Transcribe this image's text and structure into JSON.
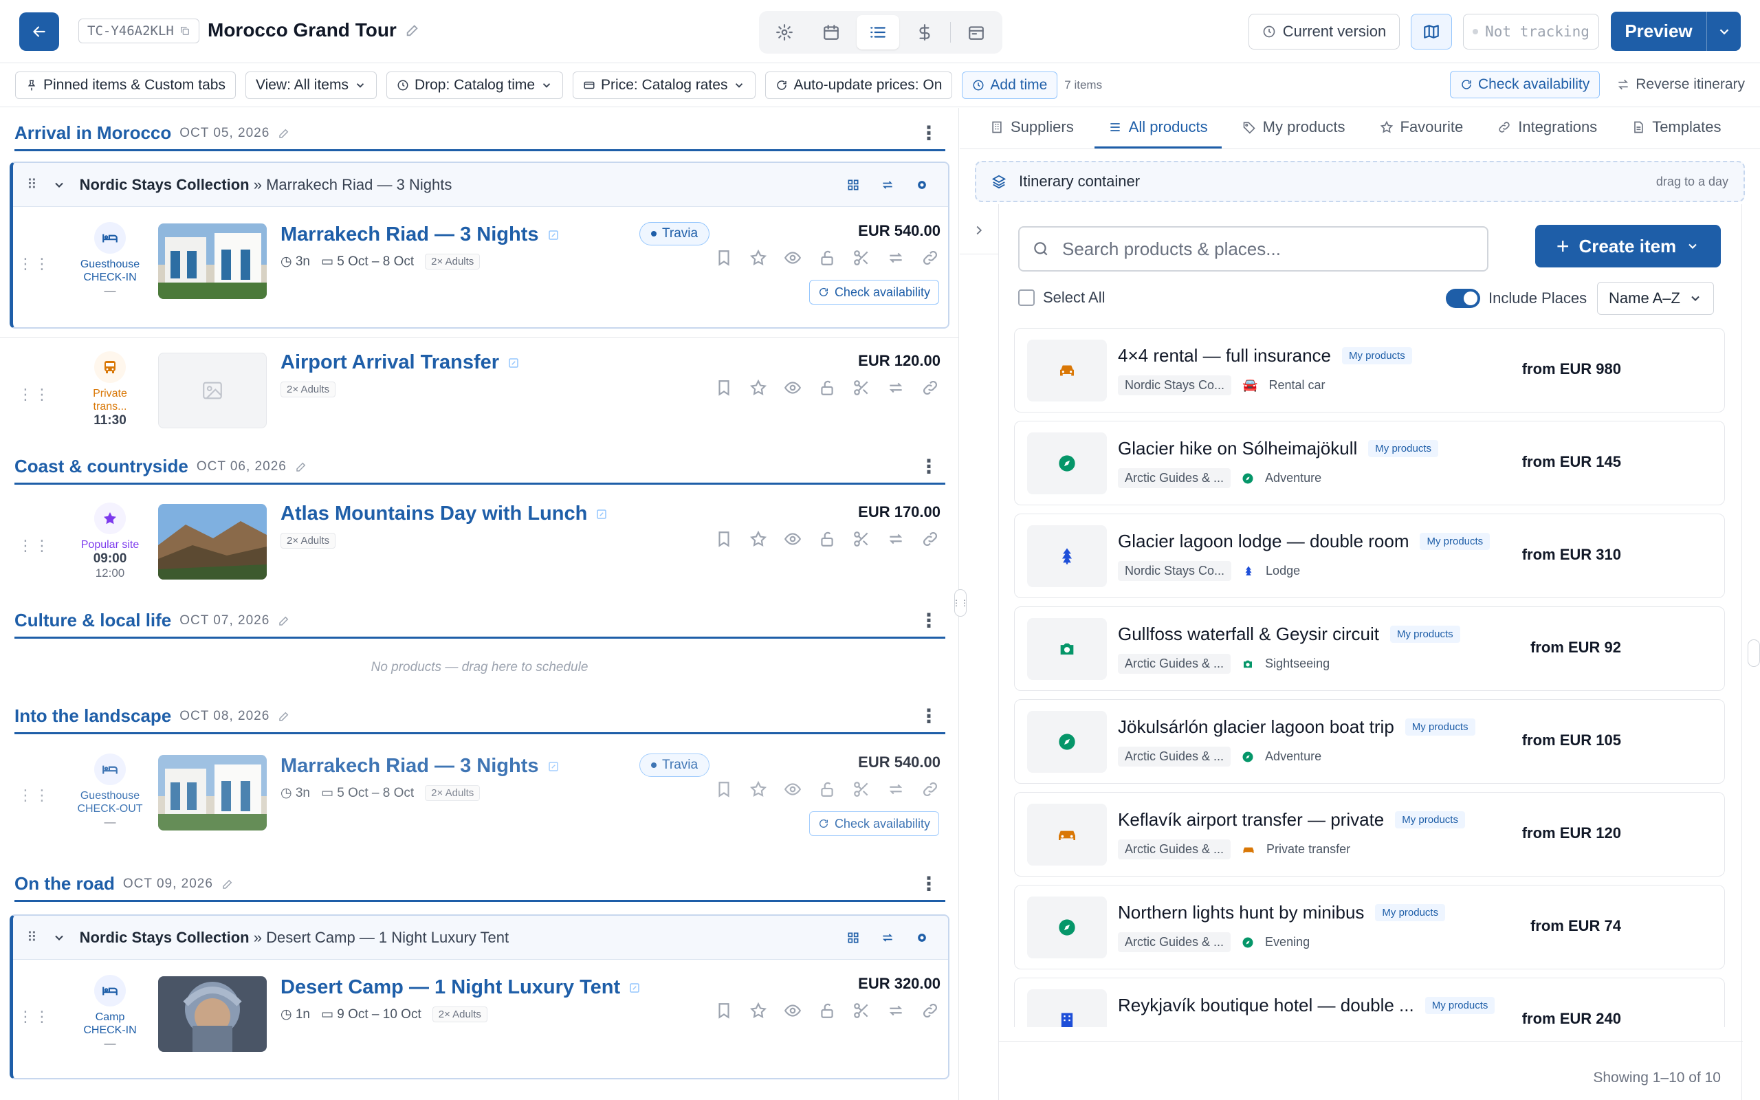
{
  "header": {
    "trip_code": "TC-Y46A2KLH",
    "title": "Morocco Grand Tour",
    "current_version": "Current version",
    "tracking": "Not tracking",
    "preview": "Preview"
  },
  "toolbar": {
    "pinned": "Pinned items & Custom tabs",
    "view": "View: All items",
    "drop": "Drop: Catalog time",
    "price": "Price: Catalog rates",
    "autoupdate": "Auto-update prices: On",
    "add_time": "Add time",
    "items_count": "7 items",
    "check_availability": "Check availability",
    "reverse": "Reverse itinerary"
  },
  "itinerary": {
    "days": [
      {
        "title": "Arrival in Morocco",
        "date": "OCT 05, 2026"
      },
      {
        "title": "Coast & countryside",
        "date": "OCT 06, 2026"
      },
      {
        "title": "Culture & local life",
        "date": "OCT 07, 2026",
        "empty_text": "No products — drag here to schedule"
      },
      {
        "title": "Into the landscape",
        "date": "OCT 08, 2026"
      },
      {
        "title": "On the road",
        "date": "OCT 09, 2026"
      }
    ],
    "groups": [
      {
        "collection": "Nordic Stays Collection",
        "sep": "»",
        "name": "Marrakech Riad — 3 Nights"
      },
      {
        "collection": "Nordic Stays Collection",
        "sep": "»",
        "name": "Desert Camp — 1 Night Luxury Tent"
      }
    ],
    "items": [
      {
        "name": "Marrakech Riad — 3 Nights",
        "type": "Guesthouse",
        "sub": "CHECK-IN",
        "dash": "—",
        "nights": "3n",
        "dates": "5 Oct – 8 Oct",
        "pax": "2× Adults",
        "supplier": "Travia",
        "price": "EUR 540.00",
        "check": "Check availability"
      },
      {
        "name": "Airport Arrival Transfer",
        "type": "Private trans...",
        "time": "11:30",
        "pax": "2× Adults",
        "price": "EUR 120.00"
      },
      {
        "name": "Atlas Mountains Day with Lunch",
        "type": "Popular site",
        "time": "09:00",
        "end": "12:00",
        "pax": "2× Adults",
        "price": "EUR 170.00"
      },
      {
        "name": "Marrakech Riad — 3 Nights",
        "type": "Guesthouse",
        "sub": "CHECK-OUT",
        "dash": "—",
        "nights": "3n",
        "dates": "5 Oct – 8 Oct",
        "pax": "2× Adults",
        "supplier": "Travia",
        "price": "EUR 540.00",
        "check": "Check availability"
      },
      {
        "name": "Desert Camp — 1 Night Luxury Tent",
        "type": "Camp",
        "sub": "CHECK-IN",
        "dash": "—",
        "nights": "1n",
        "dates": "9 Oct – 10 Oct",
        "pax": "2× Adults",
        "price": "EUR 320.00"
      }
    ]
  },
  "catalog": {
    "tabs": [
      "Suppliers",
      "All products",
      "My products",
      "Favourite",
      "Integrations",
      "Templates"
    ],
    "container": {
      "label": "Itinerary container",
      "hint": "drag to a day"
    },
    "search_placeholder": "Search products & places...",
    "create": "Create item",
    "select_all": "Select All",
    "include_places": "Include Places",
    "sort": "Name A–Z",
    "badge": "My products",
    "products": [
      {
        "title": "4×4 rental — full insurance",
        "supplier": "Nordic Stays Co...",
        "category": "Rental car",
        "price": "from EUR 980",
        "icon": "car",
        "color": "#d97706"
      },
      {
        "title": "Glacier hike on Sólheimajökull",
        "supplier": "Arctic Guides & ...",
        "category": "Adventure",
        "price": "from EUR 145",
        "icon": "compass",
        "color": "#059669"
      },
      {
        "title": "Glacier lagoon lodge — double room",
        "supplier": "Nordic Stays Co...",
        "category": "Lodge",
        "price": "from EUR 310",
        "icon": "tree",
        "color": "#1d4ed8"
      },
      {
        "title": "Gullfoss waterfall & Geysir circuit",
        "supplier": "Arctic Guides & ...",
        "category": "Sightseeing",
        "price": "from EUR 92",
        "icon": "camera",
        "color": "#059669"
      },
      {
        "title": "Jökulsárlón glacier lagoon boat trip",
        "supplier": "Arctic Guides & ...",
        "category": "Adventure",
        "price": "from EUR 105",
        "icon": "compass",
        "color": "#059669"
      },
      {
        "title": "Keflavík airport transfer — private",
        "supplier": "Arctic Guides & ...",
        "category": "Private transfer",
        "price": "from EUR 120",
        "icon": "taxi",
        "color": "#d97706"
      },
      {
        "title": "Northern lights hunt by minibus",
        "supplier": "Arctic Guides & ...",
        "category": "Evening",
        "price": "from EUR 74",
        "icon": "compass",
        "color": "#059669"
      },
      {
        "title": "Reykjavík boutique hotel — double ...",
        "supplier": "",
        "category": "",
        "price": "from EUR 240",
        "icon": "building",
        "color": "#1d4ed8"
      }
    ],
    "showing": "Showing 1–10 of 10"
  }
}
